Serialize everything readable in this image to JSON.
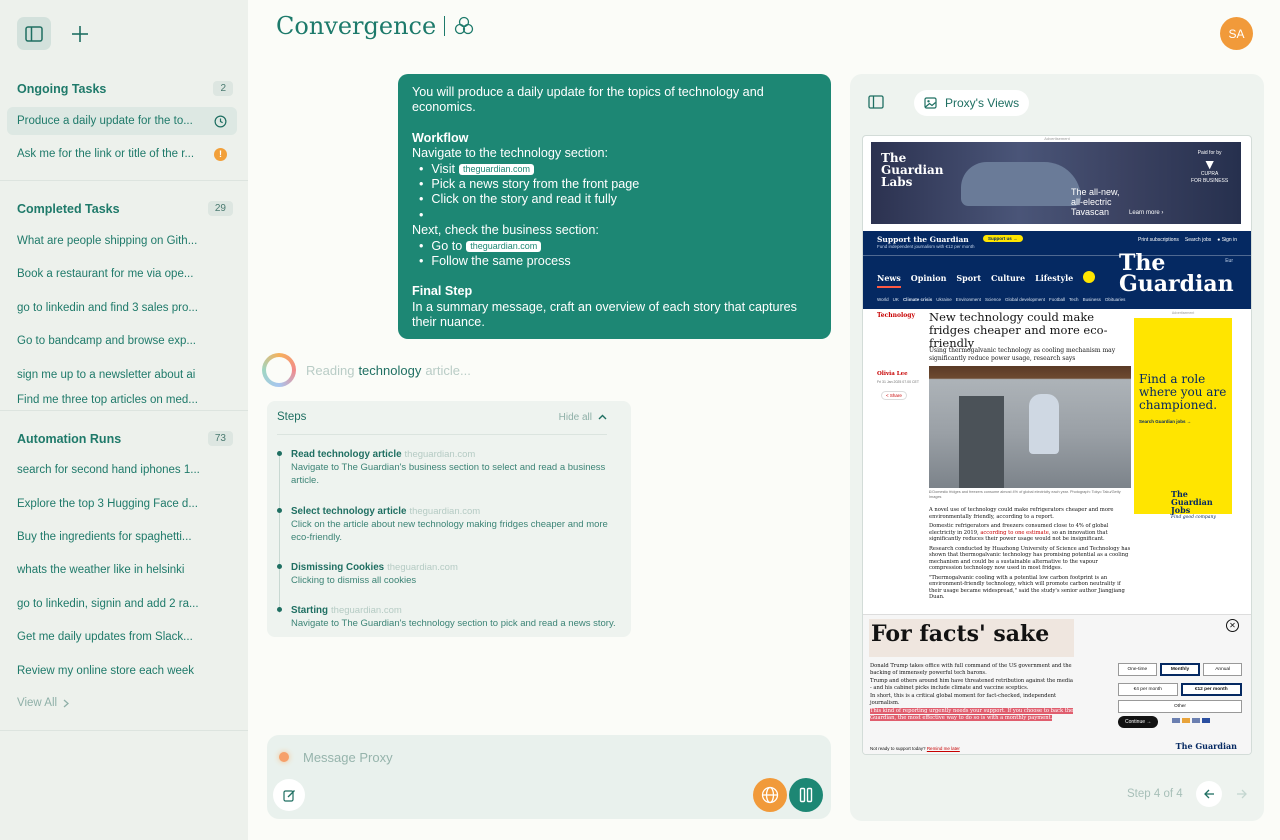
{
  "sidebar": {
    "ongoing": {
      "title": "Ongoing Tasks",
      "count": "2",
      "items": [
        {
          "label": "Produce a daily update for the to..."
        },
        {
          "label": "Ask me for the link or title of the r..."
        }
      ],
      "badge": "!"
    },
    "completed": {
      "title": "Completed Tasks",
      "count": "29",
      "items": [
        {
          "label": "What are people shipping on Gith..."
        },
        {
          "label": "Book a restaurant for me via ope..."
        },
        {
          "label": "go to linkedin and find 3 sales pro..."
        },
        {
          "label": "Go to bandcamp and browse exp..."
        },
        {
          "label": "sign me up to a newsletter about ai"
        },
        {
          "label": "Find me three top articles on med..."
        }
      ]
    },
    "automation": {
      "title": "Automation Runs",
      "count": "73",
      "items": [
        {
          "label": "search for second hand iphones 1..."
        },
        {
          "label": "Explore the top 3 Hugging Face d..."
        },
        {
          "label": "Buy the ingredients for spaghetti..."
        },
        {
          "label": "whats the weather like in helsinki"
        },
        {
          "label": "go to linkedin, signin and add 2 ra..."
        },
        {
          "label": "Get me daily updates from Slack..."
        },
        {
          "label": "Review my online store each week"
        }
      ]
    },
    "view_all": "View All"
  },
  "header": {
    "brand": "Convergence",
    "avatar_initials": "SA"
  },
  "message": {
    "intro": "You will produce a daily update for the topics of technology and economics.",
    "workflow_title": "Workflow",
    "nav_line": "Navigate to the technology section:",
    "visit": "Visit",
    "site_chip": "theguardian.com",
    "pick": "Pick a news story from the front page",
    "click": "Click on the story and read it fully",
    "next_line": "Next, check the business section:",
    "goto": "Go to",
    "follow": "Follow the same process",
    "final_title": "Final Step",
    "final_text": "In a summary message, craft an overview of each story that captures their nuance."
  },
  "status": {
    "prefix": "Reading",
    "text": "technology",
    "suffix": "article..."
  },
  "steps": {
    "title": "Steps",
    "hide_all": "Hide all",
    "items": [
      {
        "title": "Read technology article",
        "source": "theguardian.com",
        "desc": "Navigate to The Guardian's business section to select and read a business article."
      },
      {
        "title": "Select technology article",
        "source": "theguardian.com",
        "desc": "Click on the article about new technology making fridges cheaper and more eco-friendly."
      },
      {
        "title": "Dismissing Cookies",
        "source": "theguardian.com",
        "desc": "Clicking to dismiss all cookies"
      },
      {
        "title": "Starting",
        "source": "theguardian.com",
        "desc": "Navigate to The Guardian's technology section to pick and read a news story."
      }
    ]
  },
  "input": {
    "placeholder": "Message Proxy"
  },
  "panel": {
    "title": "Proxy's Views",
    "step_label": "Step 4 of 4"
  },
  "guardian": {
    "ad_label": "Advertisement",
    "labs": "The Guardian Labs",
    "ad_text": "The all-new, all-electric Tavascan",
    "learn_more": "Learn more ›",
    "paid_for": "Paid for by",
    "cupra": "CUPRA",
    "for_business": "FOR BUSINESS",
    "support": "Support the Guardian",
    "support_sub": "Fund independent journalism with €12 per month",
    "support_btn": "Support us →",
    "print": "Print subscriptions",
    "jobs": "Search jobs",
    "signin": "Sign in",
    "eur": "Eur",
    "tabs": [
      "News",
      "Opinion",
      "Sport",
      "Culture",
      "Lifestyle"
    ],
    "logo": "The Guardian",
    "sublinks": [
      "World",
      "UK",
      "Climate crisis",
      "Ukraine",
      "Environment",
      "Science",
      "Global development",
      "Football",
      "Tech",
      "Business",
      "Obituaries"
    ],
    "section": "Technology",
    "headline": "New technology could make fridges cheaper and more eco-friendly",
    "standfirst": "Using thermogalvanic technology as cooling mechanism may significantly reduce power usage, research says",
    "author": "Olivia Lee",
    "date": "Fri 31 Jan 2025 07.00 CET",
    "share": "Share",
    "caption": "Domestic fridges and freezers consume almost 4% of global electricity each year. Photograph: Tokyo Taku/Getty Images",
    "p1": "A novel use of technology could make refrigerators cheaper and more environmentally friendly, according to a report.",
    "p2a": "Domestic refrigerators and freezers consumed close to 4% of global electricity in 2019,",
    "p2link": "according to one estimate",
    "p2b": ", so an innovation that significantly reduces their power usage would not be insignificant.",
    "p3": "Research conducted by Huazhong University of Science and Technology has shown that thermogalvanic technology has promising potential as a cooling mechanism and could be a sustainable alternative to the vapour compression technology now used in most fridges.",
    "p4": "\"Thermogalvanic cooling with a potential low carbon footprint is an environment-friendly technology, which will promote carbon neutrality if their usage became widespread,\" said the study's senior author Jiangjiang Duan.",
    "side_label": "Advertisement",
    "side_ad": "Find a role where you are championed.",
    "side_link": "Search Guardian jobs →",
    "side_logo": "The Guardian Jobs",
    "side_logo_sub": "Find good company",
    "facts": "For facts' sake",
    "close": "✕",
    "b1": "Donald Trump takes office with full command of the US government and the backing of immensely powerful tech barons.",
    "b2": "Trump and others around him have threatened retribution against the media - and his cabinet picks include climate and vaccine sceptics.",
    "b3": "In short, this is a critical global moment for fact-checked, independent journalism.",
    "b4": "This kind of reporting urgently needs your support. If you choose to back the Guardian, the most effective way to do so is with a monthly payment.",
    "opt_once": "One-time",
    "opt_monthly": "Monthly",
    "opt_annual": "Annual",
    "opt_4": "€4 per month",
    "opt_12": "€12 per month",
    "opt_other": "Other",
    "continue": "Continue →",
    "not_ready": "Not ready to support today?",
    "remind": "Remind me later",
    "bottom_logo": "The Guardian"
  },
  "colors": {
    "accent": "#1d8774",
    "orange": "#f19a3a",
    "sidebar_bg": "#edf1ec"
  }
}
